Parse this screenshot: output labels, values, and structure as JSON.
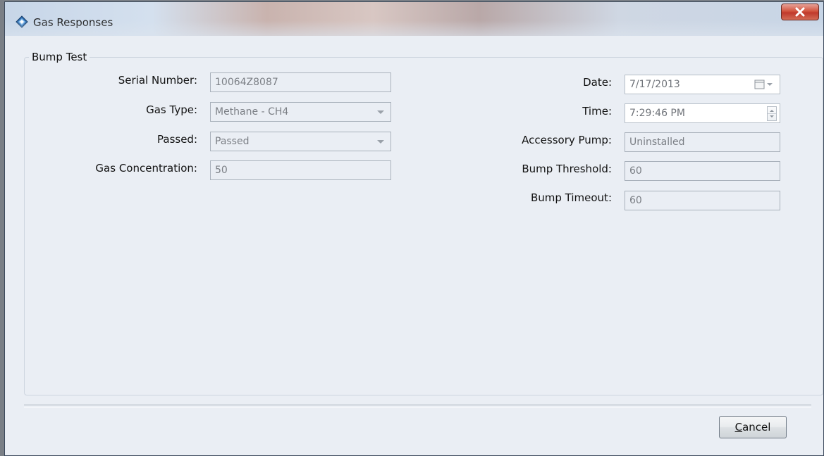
{
  "window": {
    "title": "Gas Responses"
  },
  "group": {
    "title": "Bump Test"
  },
  "left_fields": [
    {
      "label": "Serial Number:",
      "value": "10064Z8087"
    },
    {
      "label": "Gas Type:",
      "value": "Methane - CH4"
    },
    {
      "label": "Passed:",
      "value": "Passed"
    },
    {
      "label": "Gas Concentration:",
      "value": "50"
    }
  ],
  "right_fields": [
    {
      "label": "Date:",
      "value": "7/17/2013"
    },
    {
      "label": "Time:",
      "value": "7:29:46 PM"
    },
    {
      "label": "Accessory Pump:",
      "value": "Uninstalled"
    },
    {
      "label": "Bump Threshold:",
      "value": "60"
    },
    {
      "label": "Bump Timeout:",
      "value": "60"
    }
  ],
  "buttons": {
    "cancel_rest": "ancel",
    "cancel_mnemonic": "C"
  },
  "icons": {
    "app": "gas-diamond-icon",
    "close": "close-icon",
    "calendar": "calendar-icon",
    "spinner": "spinner-icon"
  }
}
